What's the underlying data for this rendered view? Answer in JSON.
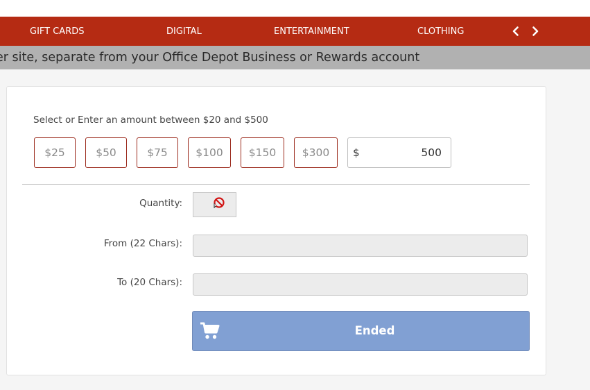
{
  "nav": {
    "items": [
      {
        "label": "GIFT CARDS"
      },
      {
        "label": "DIGITAL"
      },
      {
        "label": "ENTERTAINMENT"
      },
      {
        "label": "CLOTHING"
      }
    ],
    "prev_icon": "chevron-left-icon",
    "next_icon": "chevron-right-icon",
    "background_color": "#b52b13"
  },
  "banner": {
    "text": "er site, separate from your Office Depot Business or Rewards account"
  },
  "amount": {
    "instructions": "Select or Enter an amount between $20 and $500",
    "options": [
      "$25",
      "$50",
      "$75",
      "$100",
      "$150",
      "$300"
    ],
    "custom_currency": "$",
    "custom_value": "500"
  },
  "form": {
    "quantity_label": "Quantity:",
    "quantity_icon": "no-entry-icon",
    "from_label": "From (22 Chars):",
    "from_value": "",
    "to_label": "To (20 Chars):",
    "to_value": ""
  },
  "submit": {
    "label": "Ended",
    "icon": "cart-icon",
    "color": "#81a0d3"
  }
}
